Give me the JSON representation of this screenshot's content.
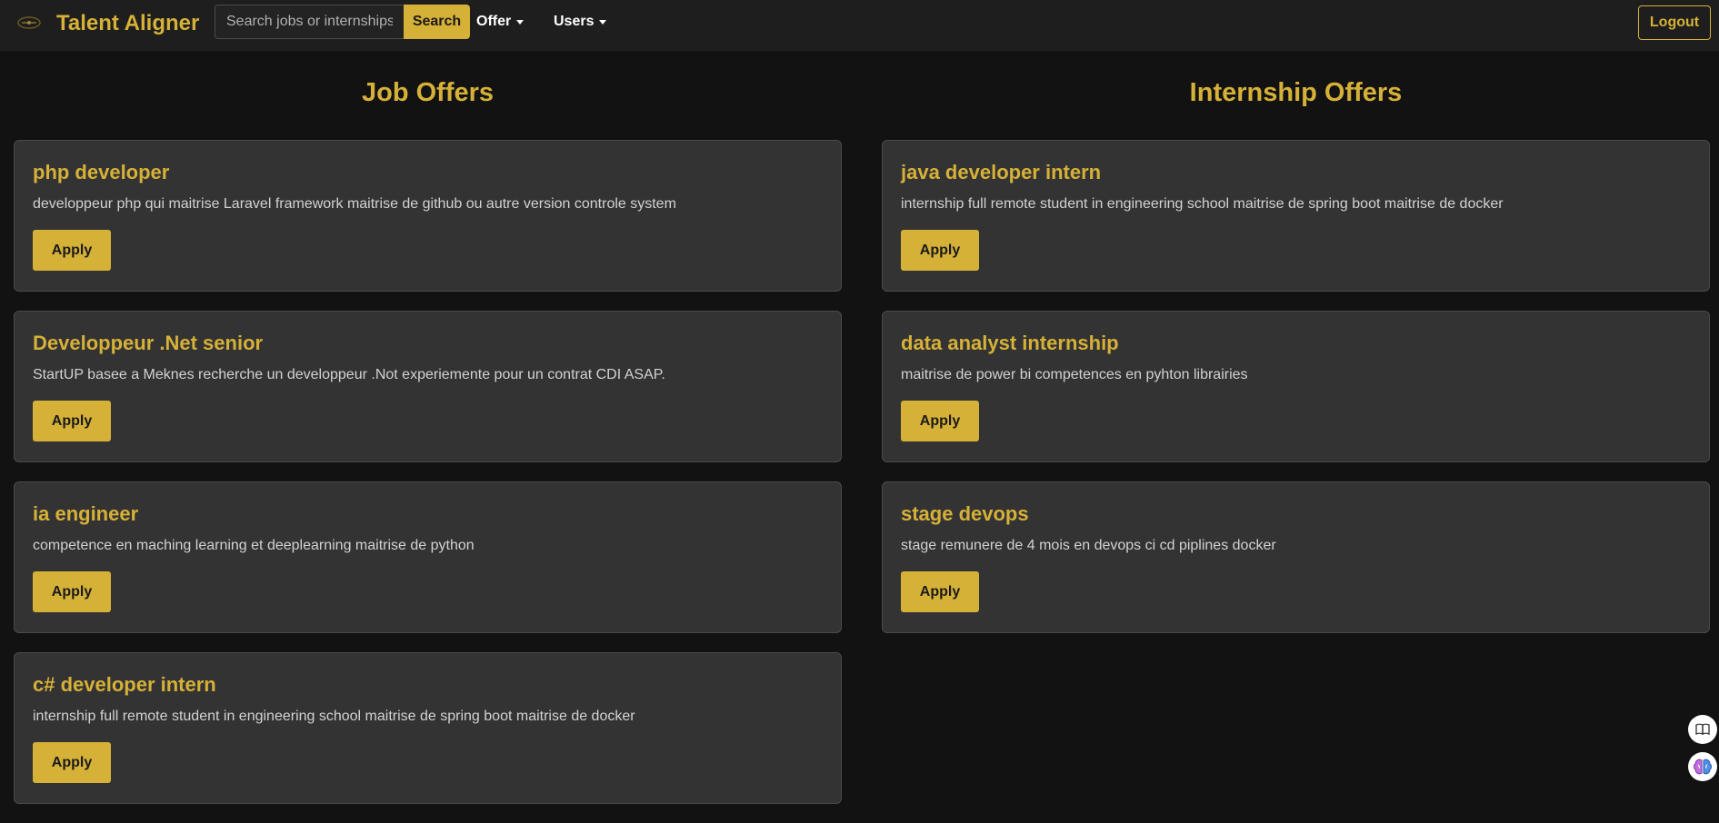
{
  "brand": {
    "name": "Talent Aligner"
  },
  "search": {
    "placeholder": "Search jobs or internships",
    "button_label": "Search"
  },
  "nav": {
    "offer_label": "Offer",
    "users_label": "Users",
    "logout_label": "Logout"
  },
  "job_offers": {
    "title": "Job Offers",
    "items": [
      {
        "title": "php developer",
        "description": "developpeur php qui maitrise Laravel framework maitrise de github ou autre version controle system",
        "apply_label": "Apply"
      },
      {
        "title": "Developpeur .Net senior",
        "description": "StartUP basee a Meknes recherche un developpeur .Not experiemente pour un contrat CDI ASAP.",
        "apply_label": "Apply"
      },
      {
        "title": "ia engineer",
        "description": "competence en maching learning et deeplearning maitrise de python",
        "apply_label": "Apply"
      },
      {
        "title": "c# developer intern",
        "description": "internship full remote student in engineering school maitrise de spring boot maitrise de docker",
        "apply_label": "Apply"
      }
    ]
  },
  "internship_offers": {
    "title": "Internship Offers",
    "items": [
      {
        "title": "java developer intern",
        "description": "internship full remote student in engineering school maitrise de spring boot maitrise de docker",
        "apply_label": "Apply"
      },
      {
        "title": "data analyst internship",
        "description": "maitrise de power bi competences en pyhton librairies",
        "apply_label": "Apply"
      },
      {
        "title": "stage devops",
        "description": "stage remunere de 4 mois en devops ci cd piplines docker",
        "apply_label": "Apply"
      }
    ]
  },
  "icons": {
    "logo": "brand-logo-icon",
    "reader": "book-icon",
    "assistant": "brain-icon"
  },
  "colors": {
    "accent": "#d6b138",
    "background": "#121212",
    "navbar": "#1e1e1e",
    "card": "#333333"
  }
}
